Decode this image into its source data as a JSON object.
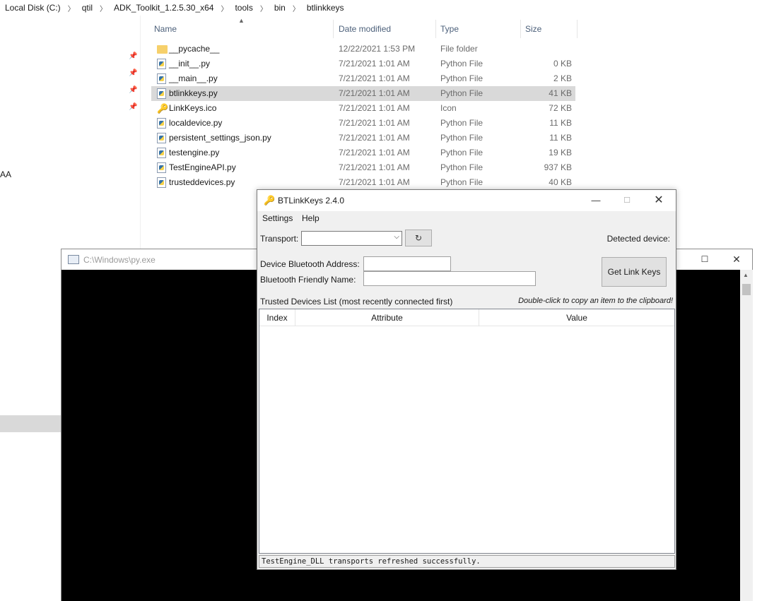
{
  "breadcrumb": [
    "Local Disk (C:)",
    "qtil",
    "ADK_Toolkit_1.2.5.30_x64",
    "tools",
    "bin",
    "btlinkkeys"
  ],
  "nav": {
    "partial_label": "AA"
  },
  "columns": {
    "name": "Name",
    "date": "Date modified",
    "type": "Type",
    "size": "Size"
  },
  "files": [
    {
      "name": "__pycache__",
      "date": "12/22/2021 1:53 PM",
      "type": "File folder",
      "size": "",
      "icon": "folder-icon"
    },
    {
      "name": "__init__.py",
      "date": "7/21/2021 1:01 AM",
      "type": "Python File",
      "size": "0 KB",
      "icon": "python-file-icon"
    },
    {
      "name": "__main__.py",
      "date": "7/21/2021 1:01 AM",
      "type": "Python File",
      "size": "2 KB",
      "icon": "python-file-icon"
    },
    {
      "name": "btlinkkeys.py",
      "date": "7/21/2021 1:01 AM",
      "type": "Python File",
      "size": "41 KB",
      "icon": "python-file-icon",
      "selected": true
    },
    {
      "name": "LinkKeys.ico",
      "date": "7/21/2021 1:01 AM",
      "type": "Icon",
      "size": "72 KB",
      "icon": "key-icon"
    },
    {
      "name": "localdevice.py",
      "date": "7/21/2021 1:01 AM",
      "type": "Python File",
      "size": "11 KB",
      "icon": "python-file-icon"
    },
    {
      "name": "persistent_settings_json.py",
      "date": "7/21/2021 1:01 AM",
      "type": "Python File",
      "size": "11 KB",
      "icon": "python-file-icon"
    },
    {
      "name": "testengine.py",
      "date": "7/21/2021 1:01 AM",
      "type": "Python File",
      "size": "19 KB",
      "icon": "python-file-icon"
    },
    {
      "name": "TestEngineAPI.py",
      "date": "7/21/2021 1:01 AM",
      "type": "Python File",
      "size": "937 KB",
      "icon": "python-file-icon"
    },
    {
      "name": "trusteddevices.py",
      "date": "7/21/2021 1:01 AM",
      "type": "Python File",
      "size": "40 KB",
      "icon": "python-file-icon"
    }
  ],
  "console": {
    "title": "C:\\Windows\\py.exe"
  },
  "btlinkkeys": {
    "title": "BTLinkKeys 2.4.0",
    "menu": {
      "settings": "Settings",
      "help": "Help"
    },
    "transport_label": "Transport:",
    "transport_value": "",
    "refresh_glyph": "↻",
    "detected_label": "Detected device:",
    "address_label": "Device Bluetooth Address:",
    "address_value": "",
    "friendly_label": "Bluetooth Friendly Name:",
    "friendly_value": "",
    "get_keys_label": "Get Link Keys",
    "trusted_label": "Trusted Devices List (most recently connected first)",
    "clipboard_hint": "Double-click to copy an item to the clipboard!",
    "table_columns": {
      "index": "Index",
      "attribute": "Attribute",
      "value": "Value"
    },
    "status": "TestEngine_DLL transports refreshed successfully."
  },
  "colors": {
    "selection": "#d9d9d9",
    "header_text": "#4c607a",
    "console_bg": "#000000",
    "dialog_bg": "#f0f0f0"
  }
}
